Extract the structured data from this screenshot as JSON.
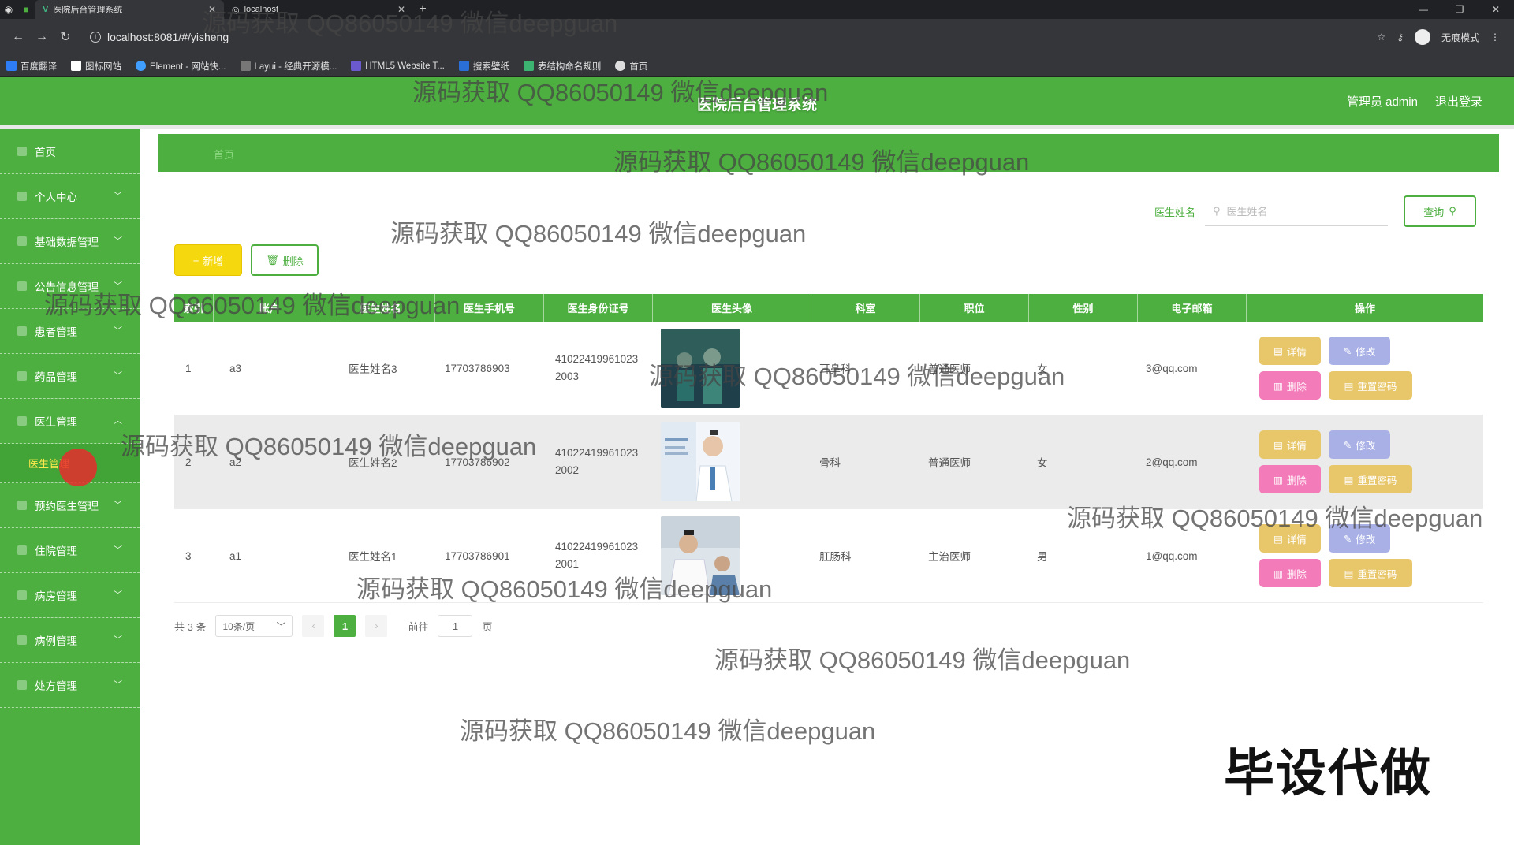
{
  "browser": {
    "tabs": [
      {
        "title": "医院后台管理系统",
        "active": true
      },
      {
        "title": "localhost",
        "active": false
      }
    ],
    "url": "localhost:8081/#/yisheng",
    "incognito_label": "无痕模式",
    "bookmarks": [
      "百度翻译",
      "图标网站",
      "Element - 网站快...",
      "Layui - 经典开源模...",
      "HTML5 Website T...",
      "搜索壁纸",
      "表结构命名规则",
      "首页"
    ]
  },
  "header": {
    "title": "医院后台管理系统",
    "user_label": "管理员 admin",
    "logout_label": "退出登录",
    "accent_color": "#4caf3f"
  },
  "sidebar": {
    "items": [
      {
        "label": "首页",
        "expandable": false
      },
      {
        "label": "个人中心",
        "expandable": true
      },
      {
        "label": "基础数据管理",
        "expandable": true
      },
      {
        "label": "公告信息管理",
        "expandable": true
      },
      {
        "label": "患者管理",
        "expandable": true
      },
      {
        "label": "药品管理",
        "expandable": true
      },
      {
        "label": "医生管理",
        "expandable": true,
        "expanded": true
      },
      {
        "label": "预约医生管理",
        "expandable": true
      },
      {
        "label": "住院管理",
        "expandable": true
      },
      {
        "label": "病房管理",
        "expandable": true
      },
      {
        "label": "病例管理",
        "expandable": true
      },
      {
        "label": "处方管理",
        "expandable": true
      }
    ],
    "active_subitem": "医生管理"
  },
  "breadcrumb": {
    "text": "首页"
  },
  "search": {
    "label": "医生姓名",
    "placeholder": "医生姓名",
    "button_label": "查询"
  },
  "toolbar": {
    "add_label": "新增",
    "delete_label": "删除"
  },
  "table": {
    "columns": [
      "索引",
      "账户",
      "医生姓名",
      "医生手机号",
      "医生身份证号",
      "医生头像",
      "科室",
      "职位",
      "性别",
      "电子邮箱",
      "操作"
    ],
    "rows": [
      {
        "index": "1",
        "account": "a3",
        "name": "医生姓名3",
        "phone": "17703786903",
        "id_line1": "41022419961023",
        "id_line2": "2003",
        "dept": "耳鼻科",
        "position": "普通医师",
        "gender": "女",
        "email": "3@qq.com"
      },
      {
        "index": "2",
        "account": "a2",
        "name": "医生姓名2",
        "phone": "17703786902",
        "id_line1": "41022419961023",
        "id_line2": "2002",
        "dept": "骨科",
        "position": "普通医师",
        "gender": "女",
        "email": "2@qq.com"
      },
      {
        "index": "3",
        "account": "a1",
        "name": "医生姓名1",
        "phone": "17703786901",
        "id_line1": "41022419961023",
        "id_line2": "2001",
        "dept": "肛肠科",
        "position": "主治医师",
        "gender": "男",
        "email": "1@qq.com"
      }
    ],
    "actions": {
      "detail": "详情",
      "edit": "修改",
      "delete": "删除",
      "reset": "重置密码"
    }
  },
  "pagination": {
    "total": "共 3 条",
    "page_size": "10条/页",
    "current_page": "1",
    "goto_label": "前往",
    "goto_value": "1",
    "page_suffix": "页"
  },
  "watermark_text": "源码获取 QQ86050149 微信deepguan",
  "corner_stamp": "毕设代做"
}
